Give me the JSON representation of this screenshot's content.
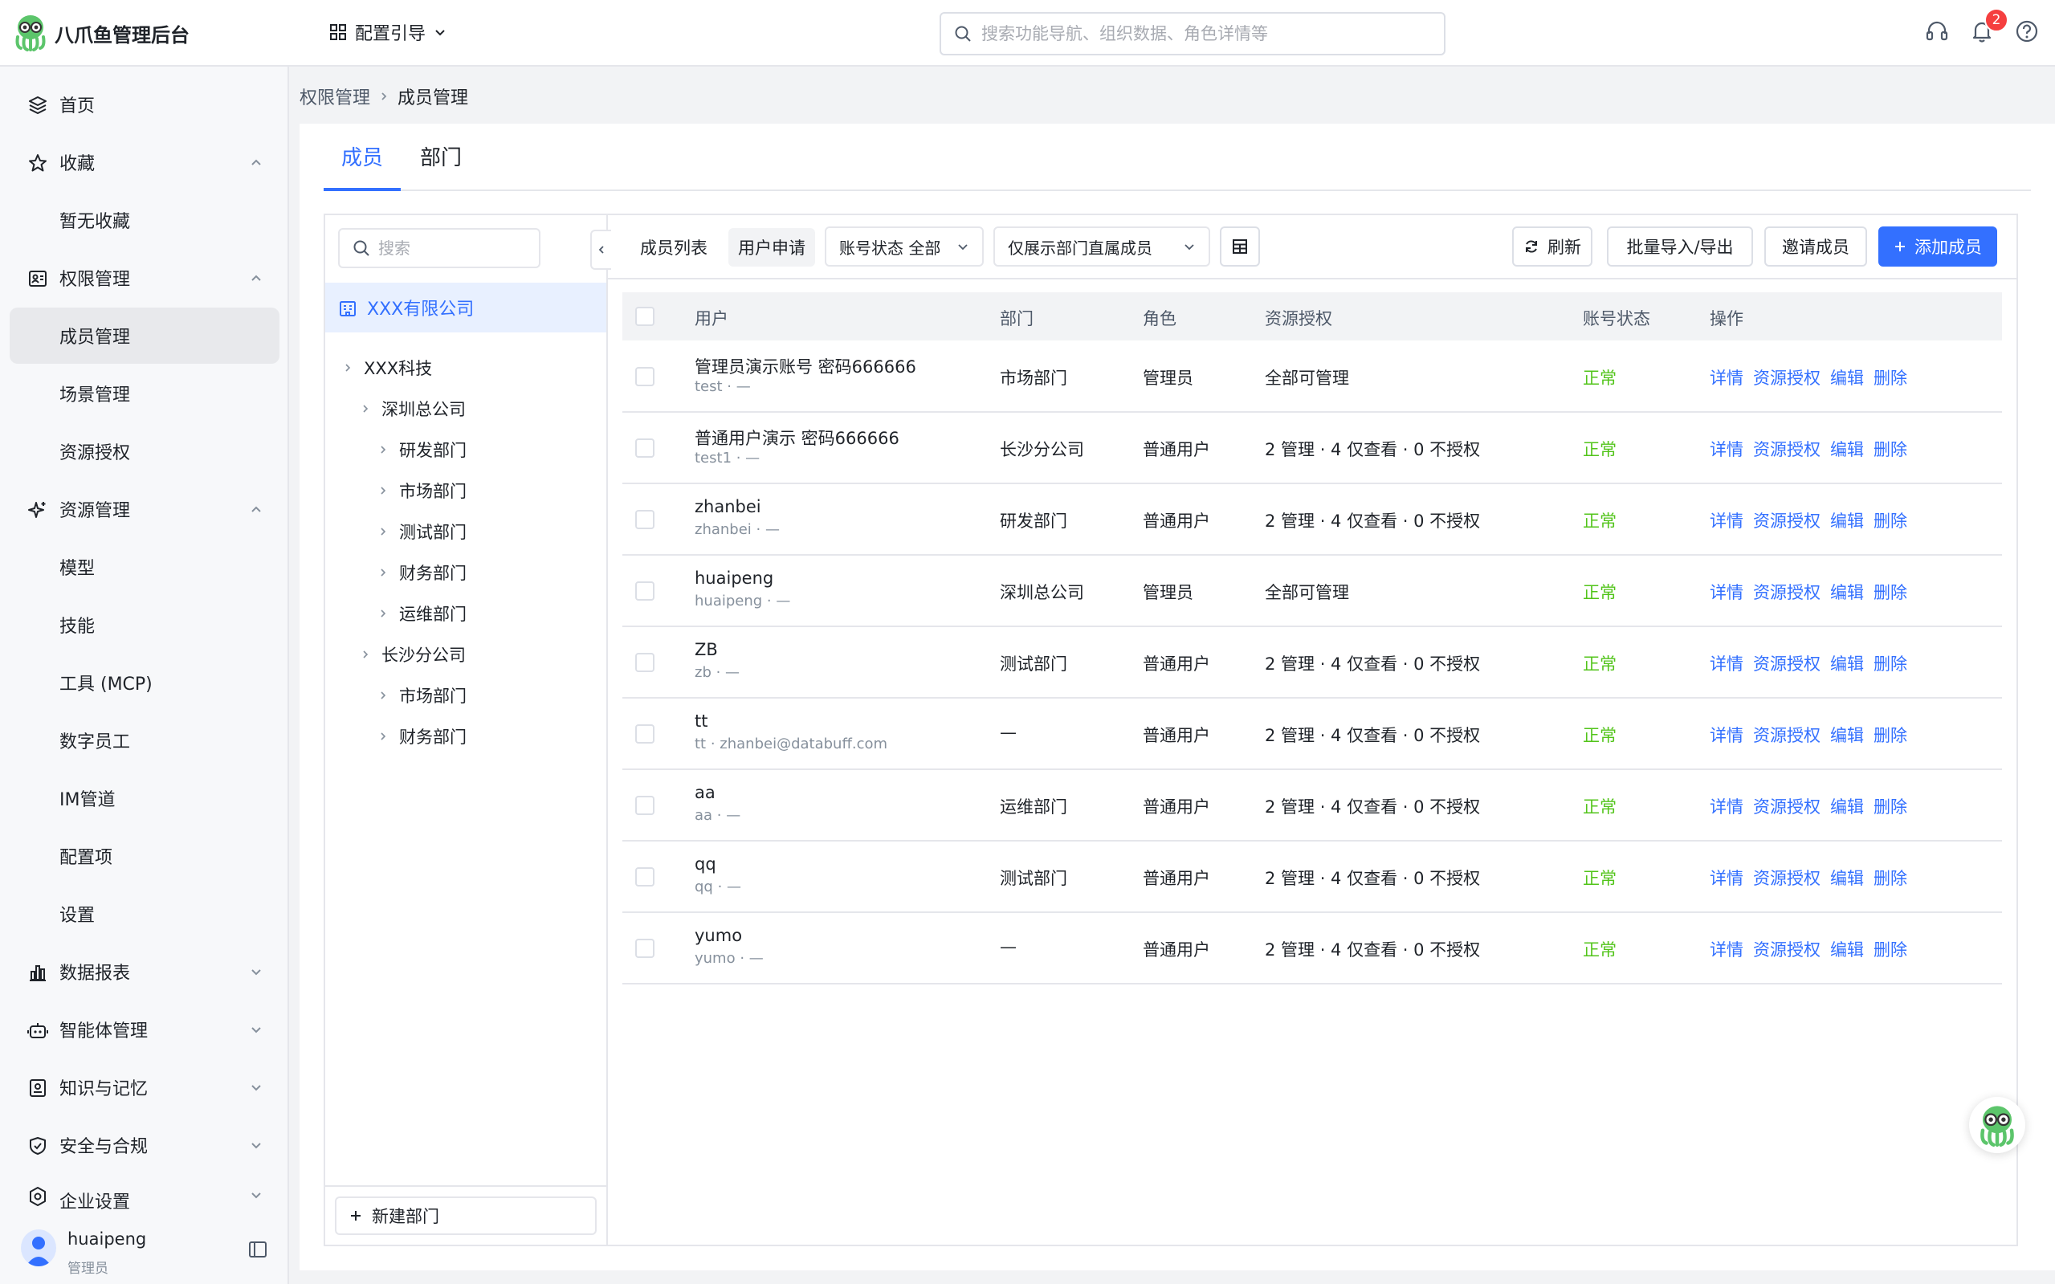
{
  "header": {
    "app_name": "八爪鱼管理后台",
    "config_guide": "配置引导",
    "search_placeholder": "搜索功能导航、组织数据、角色详情等",
    "notification_count": "2"
  },
  "sidebar": {
    "items": [
      {
        "label": "首页"
      },
      {
        "label": "收藏"
      },
      {
        "label": "暂无收藏"
      },
      {
        "label": "权限管理"
      },
      {
        "label": "成员管理"
      },
      {
        "label": "场景管理"
      },
      {
        "label": "资源授权"
      },
      {
        "label": "资源管理"
      },
      {
        "label": "模型"
      },
      {
        "label": "技能"
      },
      {
        "label": "工具 (MCP)"
      },
      {
        "label": "数字员工"
      },
      {
        "label": "IM管道"
      },
      {
        "label": "配置项"
      },
      {
        "label": "设置"
      },
      {
        "label": "数据报表"
      },
      {
        "label": "智能体管理"
      },
      {
        "label": "知识与记忆"
      },
      {
        "label": "安全与合规"
      },
      {
        "label": "企业设置"
      }
    ],
    "user": {
      "name": "huaipeng",
      "role": "管理员"
    }
  },
  "breadcrumb": {
    "parent": "权限管理",
    "current": "成员管理"
  },
  "tabs": {
    "members": "成员",
    "departments": "部门"
  },
  "tree": {
    "search_placeholder": "搜索",
    "root": "XXX有限公司",
    "nodes": [
      "XXX科技",
      "深圳总公司",
      "研发部门",
      "市场部门",
      "测试部门",
      "财务部门",
      "运维部门",
      "长沙分公司",
      "市场部门",
      "财务部门"
    ],
    "new_dept": "新建部门"
  },
  "toolbar": {
    "member_list": "成员列表",
    "user_apply": "用户申请",
    "status_filter": "账号状态 全部",
    "dept_filter": "仅展示部门直属成员",
    "refresh": "刷新",
    "import_export": "批量导入/导出",
    "invite": "邀请成员",
    "add_member": "添加成员"
  },
  "table": {
    "headers": {
      "user": "用户",
      "dept": "部门",
      "role": "角色",
      "resource": "资源授权",
      "status": "账号状态",
      "ops": "操作"
    },
    "ops": {
      "detail": "详情",
      "grant": "资源授权",
      "edit": "编辑",
      "delete": "删除"
    },
    "rows": [
      {
        "name": "管理员演示账号 密码666666",
        "sub": "test · —",
        "dept": "市场部门",
        "role": "管理员",
        "resource": "全部可管理",
        "status": "正常"
      },
      {
        "name": "普通用户演示 密码666666",
        "sub": "test1 · —",
        "dept": "长沙分公司",
        "role": "普通用户",
        "resource": "2 管理 · 4 仅查看 · 0 不授权",
        "status": "正常"
      },
      {
        "name": "zhanbei",
        "sub": "zhanbei · —",
        "dept": "研发部门",
        "role": "普通用户",
        "resource": "2 管理 · 4 仅查看 · 0 不授权",
        "status": "正常"
      },
      {
        "name": "huaipeng",
        "sub": "huaipeng · —",
        "dept": "深圳总公司",
        "role": "管理员",
        "resource": "全部可管理",
        "status": "正常"
      },
      {
        "name": "ZB",
        "sub": "zb · —",
        "dept": "测试部门",
        "role": "普通用户",
        "resource": "2 管理 · 4 仅查看 · 0 不授权",
        "status": "正常"
      },
      {
        "name": "tt",
        "sub": "tt · zhanbei@databuff.com",
        "dept": "—",
        "role": "普通用户",
        "resource": "2 管理 · 4 仅查看 · 0 不授权",
        "status": "正常"
      },
      {
        "name": "aa",
        "sub": "aa · —",
        "dept": "运维部门",
        "role": "普通用户",
        "resource": "2 管理 · 4 仅查看 · 0 不授权",
        "status": "正常"
      },
      {
        "name": "qq",
        "sub": "qq · —",
        "dept": "测试部门",
        "role": "普通用户",
        "resource": "2 管理 · 4 仅查看 · 0 不授权",
        "status": "正常"
      },
      {
        "name": "yumo",
        "sub": "yumo · —",
        "dept": "—",
        "role": "普通用户",
        "resource": "2 管理 · 4 仅查看 · 0 不授权",
        "status": "正常"
      }
    ]
  },
  "colors": {
    "accent": "#3370ff",
    "success": "#52c41a",
    "danger": "#f53f3f"
  }
}
